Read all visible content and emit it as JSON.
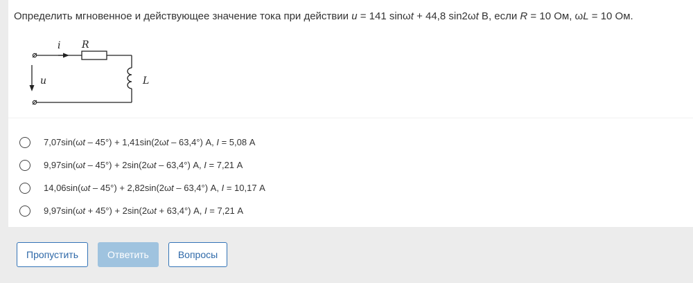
{
  "question": {
    "text_parts": [
      {
        "t": "Определить мгновенное и действующее значение тока при действии ",
        "i": false
      },
      {
        "t": "u",
        "i": true
      },
      {
        "t": " = 141 sinω",
        "i": false
      },
      {
        "t": "t",
        "i": true
      },
      {
        "t": " + 44,8 sin2ω",
        "i": false
      },
      {
        "t": "t",
        "i": true
      },
      {
        "t": " В, если ",
        "i": false
      },
      {
        "t": "R",
        "i": true
      },
      {
        "t": " = 10 Ом, ω",
        "i": false
      },
      {
        "t": "L",
        "i": true
      },
      {
        "t": " = 10 Ом.",
        "i": false
      }
    ]
  },
  "circuit": {
    "current_label": "i",
    "resistor_label": "R",
    "inductor_label": "L",
    "voltage_label": "u"
  },
  "answers": [
    {
      "parts": [
        {
          "t": "7,07sin(ω",
          "i": false
        },
        {
          "t": "t",
          "i": true
        },
        {
          "t": " – 45°) + 1,41sin(2ω",
          "i": false
        },
        {
          "t": "t",
          "i": true
        },
        {
          "t": " – 63,4°) А, ",
          "i": false
        },
        {
          "t": "I",
          "i": true
        },
        {
          "t": " = 5,08 А",
          "i": false
        }
      ]
    },
    {
      "parts": [
        {
          "t": "9,97sin(ω",
          "i": false
        },
        {
          "t": "t",
          "i": true
        },
        {
          "t": " – 45°) + 2sin(2ω",
          "i": false
        },
        {
          "t": "t",
          "i": true
        },
        {
          "t": " – 63,4°) А, ",
          "i": false
        },
        {
          "t": "I",
          "i": true
        },
        {
          "t": " = 7,21 А",
          "i": false
        }
      ]
    },
    {
      "parts": [
        {
          "t": "14,06sin(ω",
          "i": false
        },
        {
          "t": "t",
          "i": true
        },
        {
          "t": " – 45°) + 2,82sin(2ω",
          "i": false
        },
        {
          "t": "t",
          "i": true
        },
        {
          "t": " – 63,4°) А, ",
          "i": false
        },
        {
          "t": "I",
          "i": true
        },
        {
          "t": " = 10,17 А",
          "i": false
        }
      ]
    },
    {
      "parts": [
        {
          "t": "9,97sin(ω",
          "i": false
        },
        {
          "t": "t",
          "i": true
        },
        {
          "t": " + 45°) + 2sin(2ω",
          "i": false
        },
        {
          "t": "t",
          "i": true
        },
        {
          "t": " + 63,4°) А, ",
          "i": false
        },
        {
          "t": "I",
          "i": true
        },
        {
          "t": " = 7,21 А",
          "i": false
        }
      ]
    }
  ],
  "buttons": {
    "skip": "Пропустить",
    "answer": "Ответить",
    "questions": "Вопросы"
  },
  "colors": {
    "primary": "#3273b6",
    "primary_disabled": "#9fc3df",
    "background": "#ececec"
  }
}
